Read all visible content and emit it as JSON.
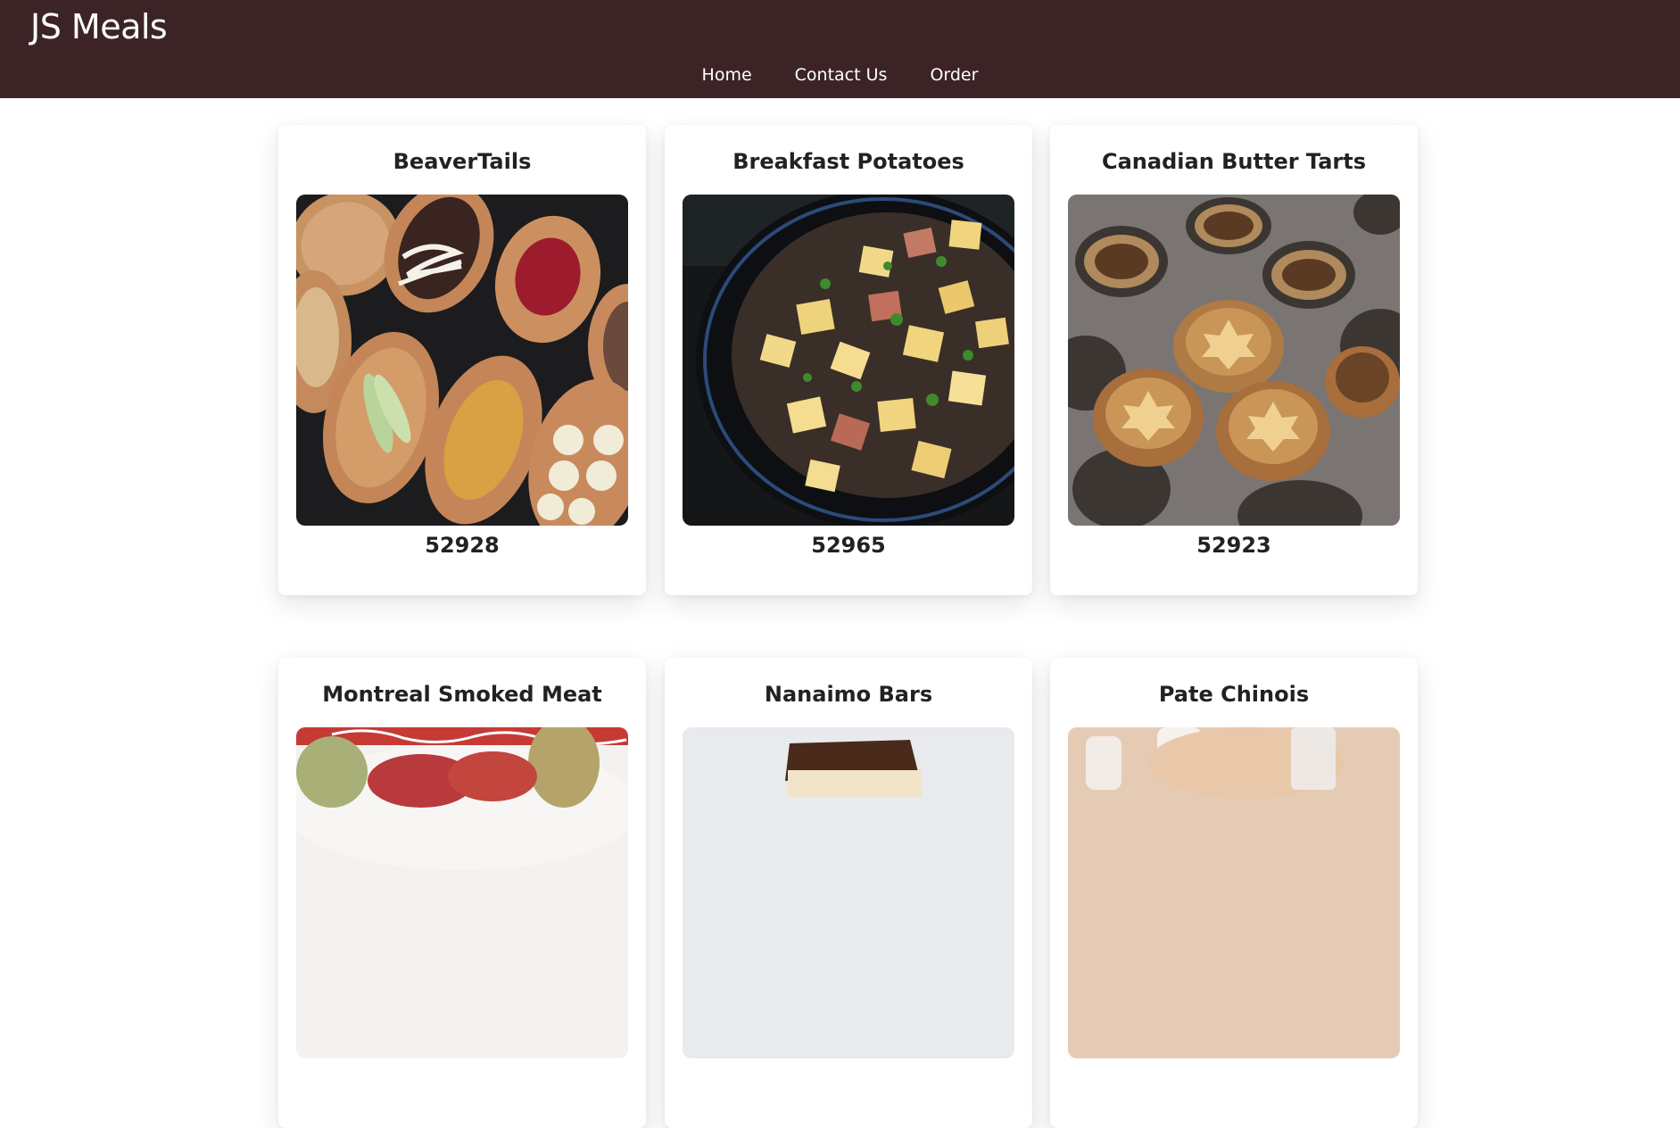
{
  "header": {
    "brand": "JS Meals",
    "nav": [
      "Home",
      "Contact Us",
      "Order"
    ]
  },
  "colors": {
    "header_bg": "#3c2426",
    "header_text": "#ffffff",
    "card_text": "#222222"
  },
  "meals": [
    {
      "name": "BeaverTails",
      "id": "52928",
      "image": "beavertails-photo"
    },
    {
      "name": "Breakfast Potatoes",
      "id": "52965",
      "image": "breakfast-potatoes-photo"
    },
    {
      "name": "Canadian Butter Tarts",
      "id": "52923",
      "image": "butter-tarts-photo"
    },
    {
      "name": "Montreal Smoked Meat",
      "id": "",
      "image": "smoked-meat-photo"
    },
    {
      "name": "Nanaimo Bars",
      "id": "",
      "image": "nanaimo-bars-photo"
    },
    {
      "name": "Pate Chinois",
      "id": "",
      "image": "pate-chinois-photo"
    }
  ]
}
